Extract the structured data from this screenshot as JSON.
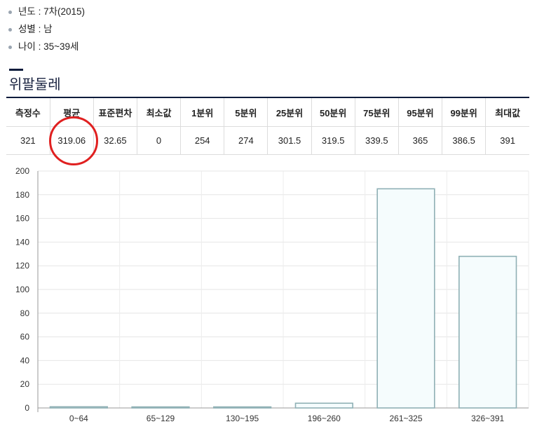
{
  "info": [
    {
      "label": "년도 : 7차(2015)"
    },
    {
      "label": "성별 : 남"
    },
    {
      "label": "나이 : 35~39세"
    }
  ],
  "section_title": "위팔둘레",
  "stats": {
    "headers": [
      "측정수",
      "평균",
      "표준편차",
      "최소값",
      "1분위",
      "5분위",
      "25분위",
      "50분위",
      "75분위",
      "95분위",
      "99분위",
      "최대값"
    ],
    "values": [
      "321",
      "319.06",
      "32.65",
      "0",
      "254",
      "274",
      "301.5",
      "319.5",
      "339.5",
      "365",
      "386.5",
      "391"
    ]
  },
  "colors": {
    "bar_fill": "#f5fcfd",
    "bar_stroke": "#8fb0b5",
    "highlight_circle": "#e02020",
    "header_rule": "#0c1c3c"
  },
  "chart_data": {
    "type": "bar",
    "categories": [
      "0~64",
      "65~129",
      "130~195",
      "196~260",
      "261~325",
      "326~391"
    ],
    "values": [
      1,
      0,
      0,
      4,
      185,
      128
    ],
    "title": "",
    "xlabel": "",
    "ylabel": "",
    "ylim": [
      0,
      200
    ],
    "yticks": [
      0,
      20,
      40,
      60,
      80,
      100,
      120,
      140,
      160,
      180,
      200
    ],
    "grid": true
  }
}
